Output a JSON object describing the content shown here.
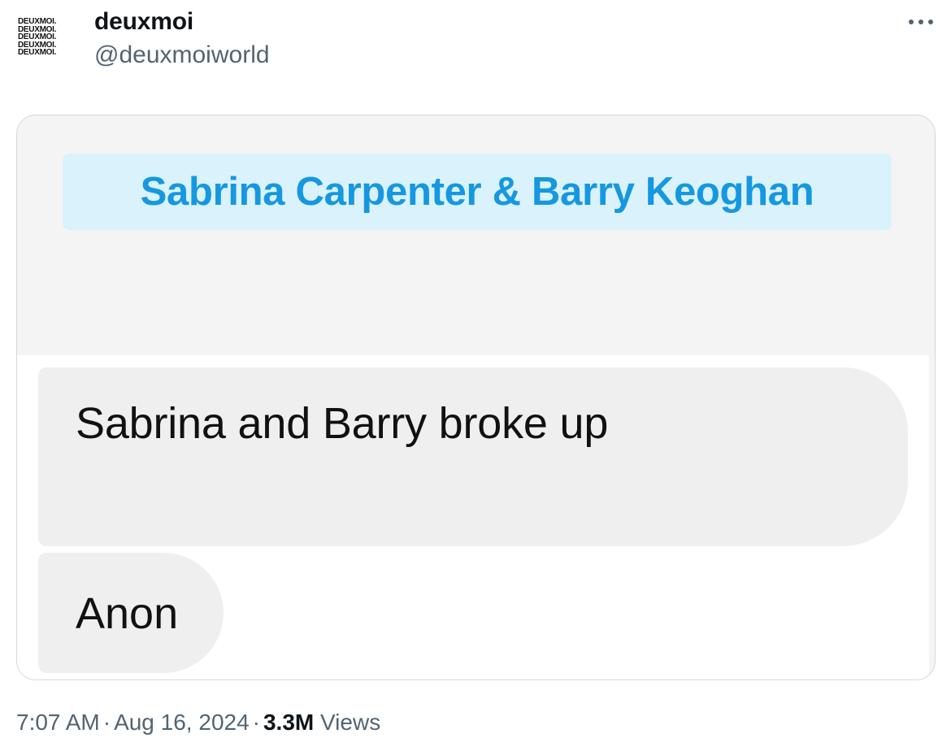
{
  "tweet": {
    "avatar_lines": [
      "DEUXMOI.",
      "DEUXMOI.",
      "DEUXMOI.",
      "DEUXMOI.",
      "DEUXMOI."
    ],
    "display_name": "deuxmoi",
    "handle": "@deuxmoiworld",
    "more_icon": "more-horizontal-icon",
    "media": {
      "title": "Sabrina Carpenter & Barry Keoghan",
      "message": "Sabrina and Barry broke up",
      "sender": "Anon"
    },
    "meta": {
      "time": "7:07 AM",
      "separator": "·",
      "date": "Aug 16, 2024",
      "views_count": "3.3M",
      "views_label": "Views"
    }
  },
  "colors": {
    "title_text": "#1698e0",
    "title_banner": "#d9f2fc",
    "bubble": "#efefef",
    "secondary_text": "#536471",
    "border": "#cfd9de"
  }
}
